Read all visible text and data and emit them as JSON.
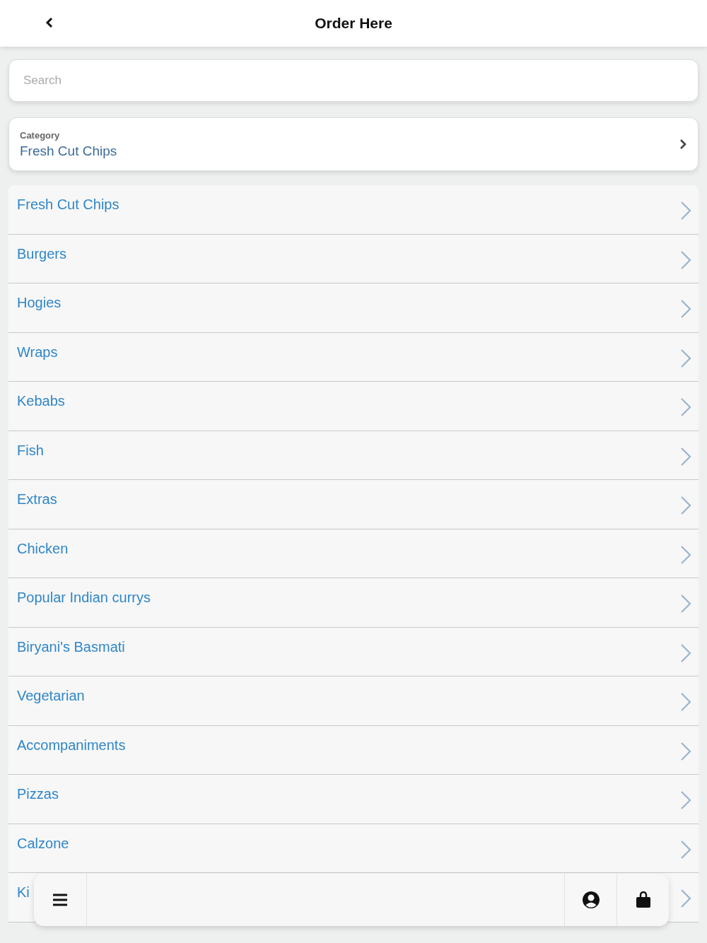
{
  "header": {
    "title": "Order Here"
  },
  "search": {
    "placeholder": "Search"
  },
  "category": {
    "label": "Category",
    "value": "Fresh Cut Chips"
  },
  "items": [
    {
      "label": "Fresh Cut Chips"
    },
    {
      "label": "Burgers"
    },
    {
      "label": "Hogies"
    },
    {
      "label": "Wraps"
    },
    {
      "label": "Kebabs"
    },
    {
      "label": "Fish"
    },
    {
      "label": "Extras"
    },
    {
      "label": "Chicken"
    },
    {
      "label": "Popular Indian currys"
    },
    {
      "label": "Biryani's Basmati"
    },
    {
      "label": "Vegetarian"
    },
    {
      "label": "Accompaniments"
    },
    {
      "label": "Pizzas"
    },
    {
      "label": "Calzone"
    },
    {
      "label": "Ki"
    }
  ]
}
